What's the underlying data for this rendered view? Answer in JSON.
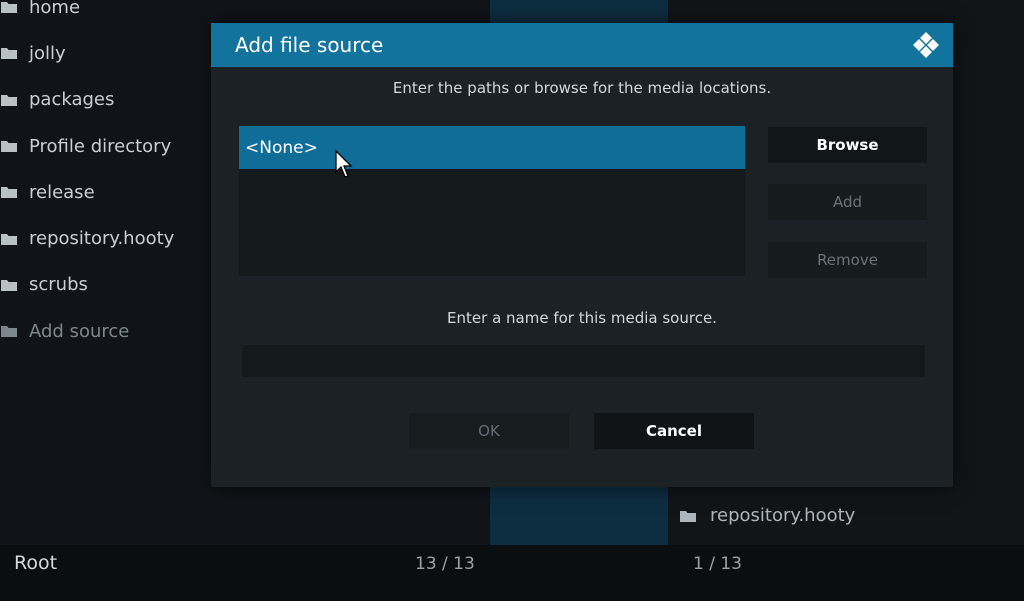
{
  "left_list": {
    "items": [
      {
        "label": "home"
      },
      {
        "label": "jolly"
      },
      {
        "label": "packages"
      },
      {
        "label": "Profile directory"
      },
      {
        "label": "release"
      },
      {
        "label": "repository.hooty"
      },
      {
        "label": "scrubs"
      },
      {
        "label": "Add source"
      }
    ]
  },
  "right_list": {
    "item": "repository.hooty"
  },
  "footer": {
    "root_label": "Root",
    "left_count": "13 / 13",
    "right_count": "1 / 13"
  },
  "dialog": {
    "title": "Add file source",
    "paths_instruction": "Enter the paths or browse for the media locations.",
    "paths": [
      "<None>"
    ],
    "browse_label": "Browse",
    "add_label": "Add",
    "remove_label": "Remove",
    "name_instruction": "Enter a name for this media source.",
    "name_value": "",
    "ok_label": "OK",
    "cancel_label": "Cancel"
  },
  "colors": {
    "accent": "#12739d",
    "selection": "#0f6d98"
  },
  "icons": {
    "folder": "folder-icon",
    "logo": "kodi-logo-icon",
    "cursor": "mouse-pointer-icon"
  }
}
